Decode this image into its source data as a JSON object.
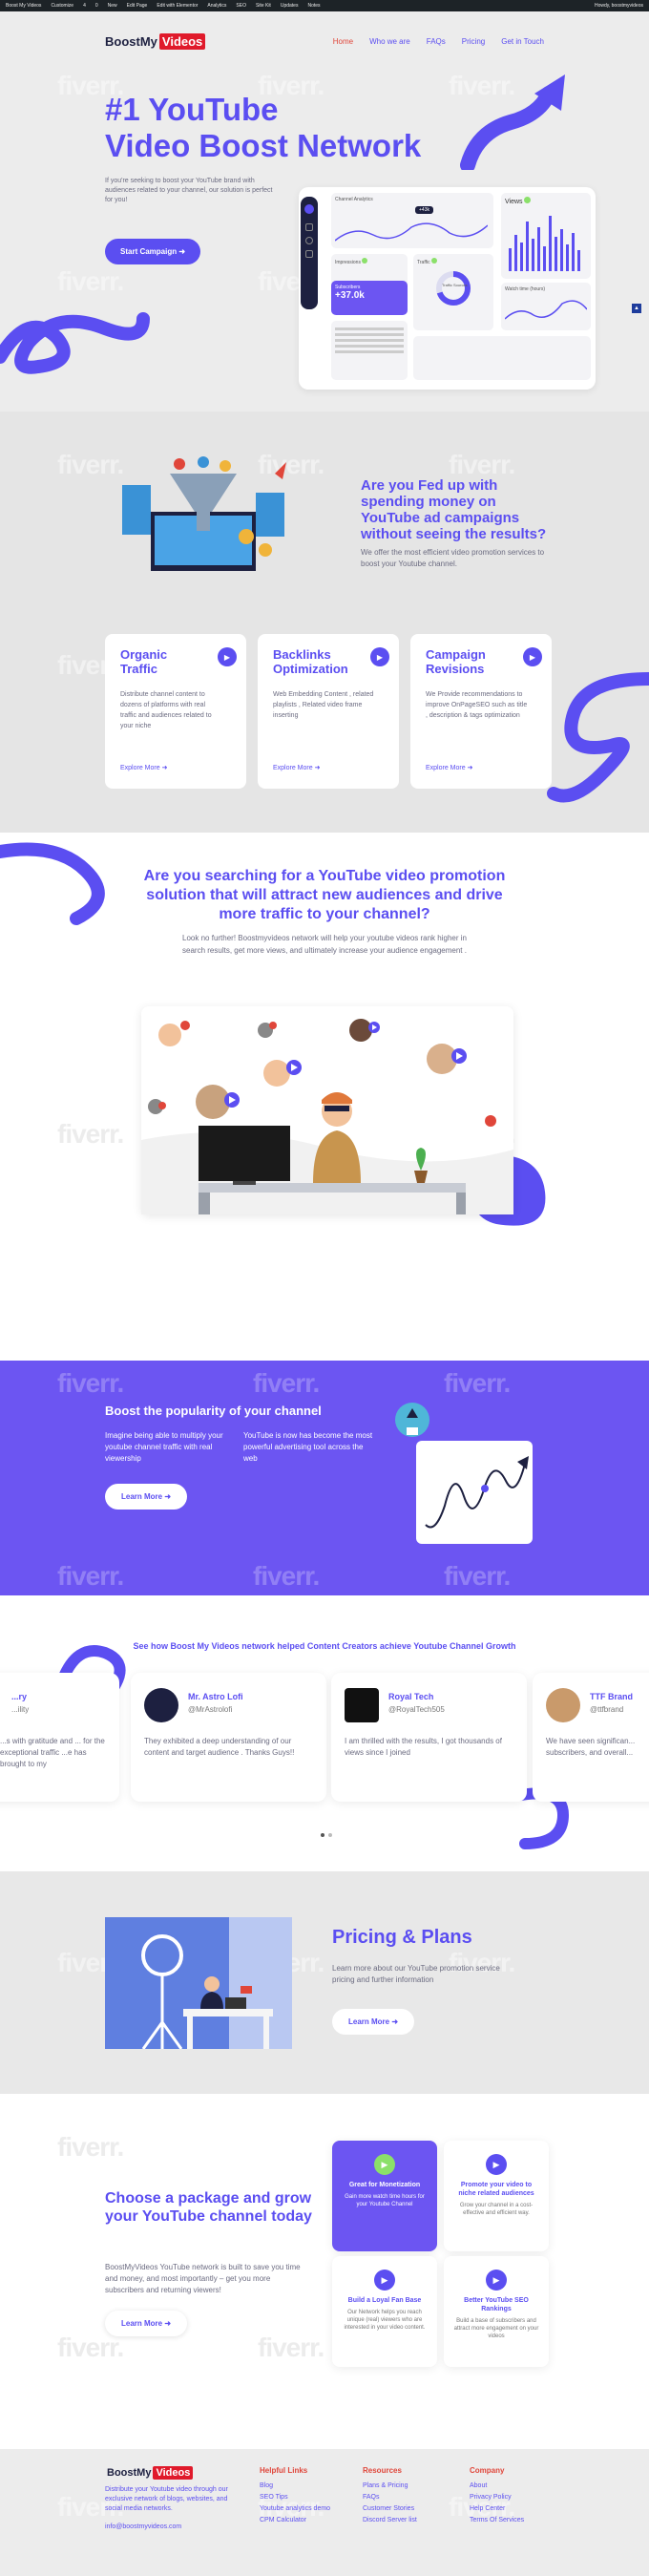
{
  "admin_bar": {
    "items": [
      "Boost My Videos",
      "Customize",
      "4",
      "0",
      "New",
      "Edit Page",
      "Edit with Elementor",
      "Analytics",
      "SEO",
      "Site Kit",
      "Updates",
      "Notes"
    ],
    "greeting": "Howdy, boostmyvideos"
  },
  "header": {
    "logo_part1": "BoostMy",
    "logo_part2": "Videos",
    "nav": [
      "Home",
      "Who we are",
      "FAQs",
      "Pricing",
      "Get in Touch"
    ]
  },
  "hero": {
    "title_line1": "#1 YouTube",
    "title_line2": "Video Boost Network",
    "text": "If you're seeking to boost your YouTube brand with audiences related to your channel, our solution is perfect for you!",
    "cta": "Start Campaign",
    "dashboard": {
      "analytics_title": "Channel Analytics",
      "badge": "+43k",
      "views_label": "Views",
      "impressions_label": "Impressions",
      "traffic_label": "Traffic",
      "traffic_sources": "Traffic Sources",
      "watch_time": "Watch time (hours)",
      "subscribers_label": "Subscribers",
      "subscribers_value": "+37.0k"
    }
  },
  "fed_up": {
    "title": "Are you Fed up with spending money on YouTube ad campaigns without seeing the results?",
    "text": "We offer the most efficient video promotion services to boost your Youtube channel."
  },
  "features": [
    {
      "title": "Organic Traffic",
      "text": "Distribute channel content to dozens of platforms with real traffic and audiences related to your niche",
      "link": "Explore More"
    },
    {
      "title": "Backlinks Optimization",
      "text": "Web Embedding Content , related playlists , Related video frame inserting",
      "link": "Explore More"
    },
    {
      "title": "Campaign Revisions",
      "text": "We Provide recommendations to improve OnPageSEO such as title , description & tags optimization",
      "link": "Explore More"
    }
  ],
  "searching": {
    "title": "Are you searching for a YouTube video promotion solution that will attract new audiences and drive more traffic to your channel?",
    "text": "Look no further! Boostmyvideos network will help your youtube videos rank higher in search results, get more views, and ultimately increase your audience engagement ."
  },
  "boost": {
    "title": "Boost the popularity of your channel",
    "text1": "Imagine being able to multiply your youtube channel traffic with real viewership",
    "text2": "YouTube is now has become the most powerful advertising tool across the web",
    "cta": "Learn More"
  },
  "testimonials": {
    "title": "See how Boost My Videos network helped Content Creators achieve Youtube Channel Growth",
    "items": [
      {
        "name": "...ry",
        "handle": "...ility",
        "text": "...s with gratitude and ... for the exceptional traffic ...e has brought to my"
      },
      {
        "name": "Mr. Astro Lofi",
        "handle": "@MrAstrolofi",
        "text": "They exhibited a deep understanding of our content and target audience . Thanks Guys!!"
      },
      {
        "name": "Royal Tech",
        "handle": "@RoyalTech505",
        "text": "I am thrilled with the results, I got thousands of views since I joined"
      },
      {
        "name": "TTF Brand",
        "handle": "@ttfbrand",
        "text": "We have seen significan... subscribers, and overall..."
      }
    ]
  },
  "pricing": {
    "title": "Pricing & Plans",
    "text": "Learn more about our YouTube promotion service pricing and further information",
    "cta": "Learn More"
  },
  "package": {
    "title": "Choose a package and grow your YouTube channel today",
    "text": "BoostMyVideos YouTube network is built to save you time and money, and most importantly – get you more subscribers and returning viewers!",
    "cta": "Learn More",
    "cards": [
      {
        "title": "Great for Monetization",
        "text": "Gain more watch time hours for your Youtube Channel"
      },
      {
        "title": "Promote your video to niche related audiences",
        "text": "Grow your channel in a cost-effective and efficient way."
      },
      {
        "title": "Build a Loyal Fan Base",
        "text": "Our Network helps you reach unique (real) viewers who are interested in your video content."
      },
      {
        "title": "Better YouTube SEO Rankings",
        "text": "Build a base of subscribers and attract more engagement on your videos"
      }
    ]
  },
  "footer": {
    "logo_part1": "BoostMy",
    "logo_part2": "Videos",
    "about": "Distribute your Youtube video through our exclusive network of blogs, websites, and social media networks.",
    "email": "info@boostmyvideos.com",
    "columns": [
      {
        "heading": "Helpful Links",
        "items": [
          "Blog",
          "SEO Tips",
          "Youtube analytics demo",
          "CPM Calculator"
        ]
      },
      {
        "heading": "Resources",
        "items": [
          "Plans & Pricing",
          "FAQs",
          "Customer Stories",
          "Discord Server list"
        ]
      },
      {
        "heading": "Company",
        "items": [
          "About",
          "Privacy Policy",
          "Help Center",
          "Terms Of Services"
        ]
      }
    ]
  },
  "watermark": "fiverr.",
  "colors": {
    "accent": "#5b4ef1",
    "purple_bg": "#6c55f2",
    "logo_red": "#e01a2b",
    "nav_active": "#e0463a"
  }
}
